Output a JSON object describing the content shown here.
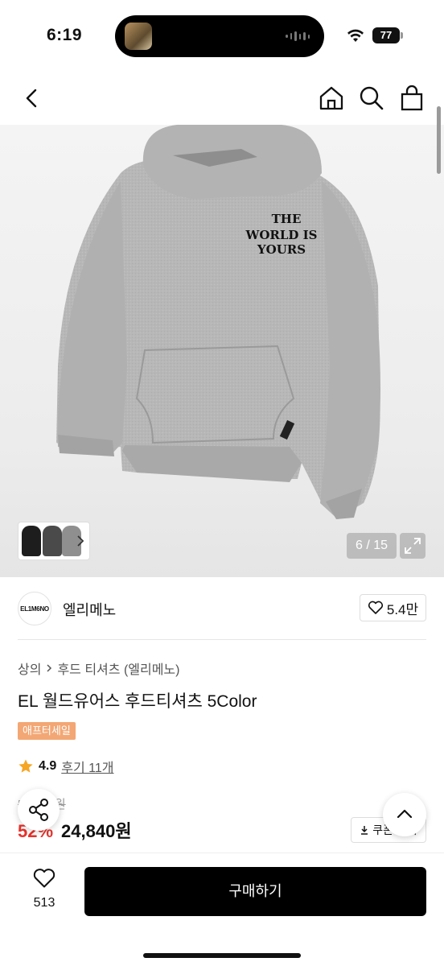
{
  "status_bar": {
    "time": "6:19",
    "battery": "77",
    "icons": [
      "wifi-icon",
      "battery-icon",
      "audio-waveform-icon"
    ]
  },
  "nav": {
    "icons": [
      "back-chevron-icon",
      "home-icon",
      "search-icon",
      "shopping-bag-icon"
    ]
  },
  "gallery": {
    "counter": "6 / 15",
    "print_lines": [
      "THE",
      "WORLD IS",
      "YOURS"
    ],
    "thumbnail_colors": [
      "#1d1d1d",
      "#4a4a4a",
      "#8f8f8f"
    ],
    "product_color": "#b7b7b7"
  },
  "brand": {
    "logo_text": "EL1M6NO",
    "name": "엘리메노",
    "likes": "5.4만"
  },
  "product": {
    "breadcrumb": [
      "상의",
      "후드 티셔츠 (엘리메노)"
    ],
    "title": "EL 월드유어스 후드티셔츠 5Color",
    "tag": "애프터세일",
    "rating": "4.9",
    "reviews": "후기 11개",
    "original_price": "5_,__0원",
    "discount": "52%",
    "price": "24,840원",
    "coupon_label": "쿠폰 받기"
  },
  "bottom_bar": {
    "wish_count": "513",
    "buy_label": "구매하기"
  },
  "colors": {
    "accent_tag": "#f3a774",
    "discount_red": "#e8322b",
    "buy_button": "#000000",
    "star": "#f5a623"
  }
}
